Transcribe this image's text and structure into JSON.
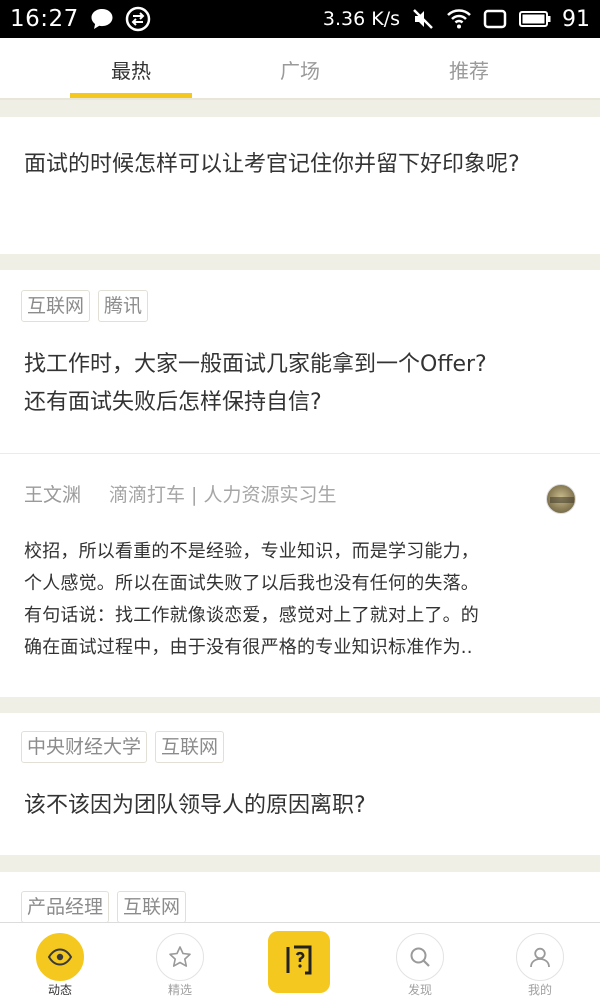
{
  "status_bar": {
    "time": "16:27",
    "speed": "3.36 K/s",
    "battery": "91",
    "icons": [
      "chat-bubble-icon",
      "sync-icon",
      "mute-icon",
      "wifi-icon",
      "screen-icon",
      "battery-icon"
    ]
  },
  "tabs": [
    {
      "label": "最热",
      "active": true
    },
    {
      "label": "广场",
      "active": false
    },
    {
      "label": "推荐",
      "active": false
    }
  ],
  "feed": {
    "q1": {
      "title": "面试的时候怎样可以让考官记住你并留下好印象呢?"
    },
    "q2": {
      "tags": [
        "互联网",
        "腾讯"
      ],
      "title_line1": "找工作时，大家一般面试几家能拿到一个Offer?",
      "title_line2": "还有面试失败后怎样保持自信?",
      "answer": {
        "author": "王文渊",
        "role": "滴滴打车 | 人力资源实习生",
        "lines": [
          "校招，所以看重的不是经验，专业知识，而是学习能力，",
          "个人感觉。所以在面试失败了以后我也没有任何的失落。",
          "有句话说：找工作就像谈恋爱，感觉对上了就对上了。的",
          "确在面试过程中，由于没有很严格的专业知识标准作为.."
        ]
      }
    },
    "q3": {
      "tags": [
        "中央财经大学",
        "互联网"
      ],
      "title": "该不该因为团队领导人的原因离职?"
    },
    "q4": {
      "tags": [
        "产品经理",
        "互联网"
      ]
    }
  },
  "bottom_nav": [
    {
      "label": "动态",
      "icon": "eye-icon",
      "active": true
    },
    {
      "label": "精选",
      "icon": "star-icon",
      "active": false
    },
    {
      "label": "",
      "icon": "ask-icon",
      "active": false
    },
    {
      "label": "发现",
      "icon": "search-icon",
      "active": false
    },
    {
      "label": "我的",
      "icon": "user-icon",
      "active": false
    }
  ],
  "colors": {
    "accent": "#f5c81f",
    "background": "#f0efe6",
    "status_bar": "#000000"
  }
}
